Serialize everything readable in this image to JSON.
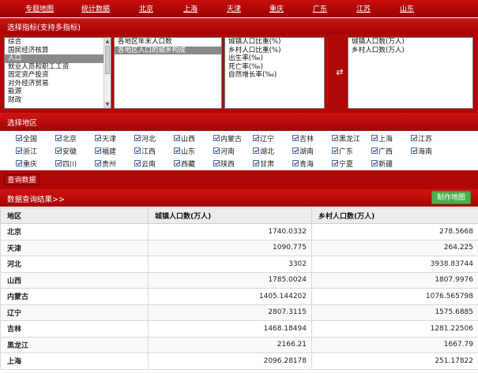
{
  "topnav": [
    "专题地图",
    "统计数据",
    "北京",
    "上海",
    "天津",
    "重庆",
    "广东",
    "江苏",
    "山东"
  ],
  "indicator": {
    "header": "选择指标(支持多指标)",
    "list1": [
      "综合",
      "国民经济核算",
      "人口",
      "就业人员和职工工资",
      "固定资产投资",
      "对外经济贸易",
      "能源",
      "财政"
    ],
    "list1_selected": 2,
    "list2": [
      "各地区年末人口数",
      "各地区人口的城乡构成"
    ],
    "list2_selected": 1,
    "list3": [
      "城镇人口比重(%)",
      "乡村人口比重(%)",
      "出生率(‰)",
      "死亡率(‰)",
      "自然增长率(‰)"
    ],
    "list4": [
      "城镇人口数(万人)",
      "乡村人口数(万人)"
    ],
    "swap_icon": "⇄"
  },
  "region": {
    "header": "选择地区",
    "rows": [
      [
        "全国",
        "北京",
        "天津",
        "河北",
        "山西",
        "内蒙古",
        "辽宁",
        "吉林",
        "黑龙江",
        "上海",
        "江苏"
      ],
      [
        "浙江",
        "安徽",
        "福建",
        "江西",
        "山东",
        "河南",
        "湖北",
        "湖南",
        "广东",
        "广西",
        "海南"
      ],
      [
        "重庆",
        "四川",
        "贵州",
        "云南",
        "西藏",
        "陕西",
        "甘肃",
        "青海",
        "宁夏",
        "新疆"
      ]
    ]
  },
  "query_button": "查询数据",
  "result": {
    "header": "数据查询结果>>",
    "map_button": "制作地图",
    "columns": [
      "地区",
      "城镇人口数(万人)",
      "乡村人口数(万人)"
    ],
    "rows": [
      [
        "北京",
        "1740.0332",
        "278.5668"
      ],
      [
        "天津",
        "1090.775",
        "264.225"
      ],
      [
        "河北",
        "3302",
        "3938.83744"
      ],
      [
        "山西",
        "1785.0024",
        "1807.9976"
      ],
      [
        "内蒙古",
        "1405.144202",
        "1076.565798"
      ],
      [
        "辽宁",
        "2807.3115",
        "1575.6885"
      ],
      [
        "吉林",
        "1468.18494",
        "1281.22506"
      ],
      [
        "黑龙江",
        "2166.21",
        "1667.79"
      ],
      [
        "上海",
        "2096.28178",
        "251.17822"
      ]
    ]
  },
  "colors": {
    "brand_red": "#b00707",
    "map_button_green": "#4cae4c"
  }
}
